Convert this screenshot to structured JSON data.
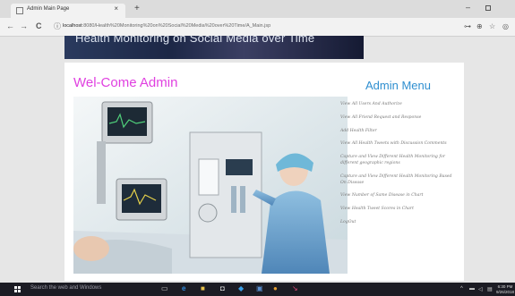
{
  "browser": {
    "tab_title": "Admin Main Page",
    "tab_close": "×",
    "new_tab": "+",
    "url_host": "localhost",
    "url_path": ":8080/Health%20Monitoring%20on%20Social%20Media%20over%20Time/A_Main.jsp",
    "back": "←",
    "forward": "→",
    "reload": "C",
    "info": "ⓘ",
    "minimize": "–"
  },
  "page": {
    "banner_title": "Health Monitoring on Social Media over Time",
    "welcome": "Wel-Come Admin",
    "menu_title": "Admin Menu",
    "menu_items": [
      "View All Users And Authorize",
      "View All Friend Request and Response",
      "Add Health Filter",
      "View All Health Tweets with Discussion Comments",
      "Capture and View Different Health Monitoring for different geographic regions",
      "Capture and View Different Health Monitoring Based On Disease",
      "View Number of Same Disease in Chart",
      "View Health Tweet Scores in Chart",
      "LogOut"
    ]
  },
  "taskbar": {
    "search_placeholder": "Search the web and Windows",
    "clock_time": "6:30 PM",
    "clock_date": "9/26/2018"
  }
}
